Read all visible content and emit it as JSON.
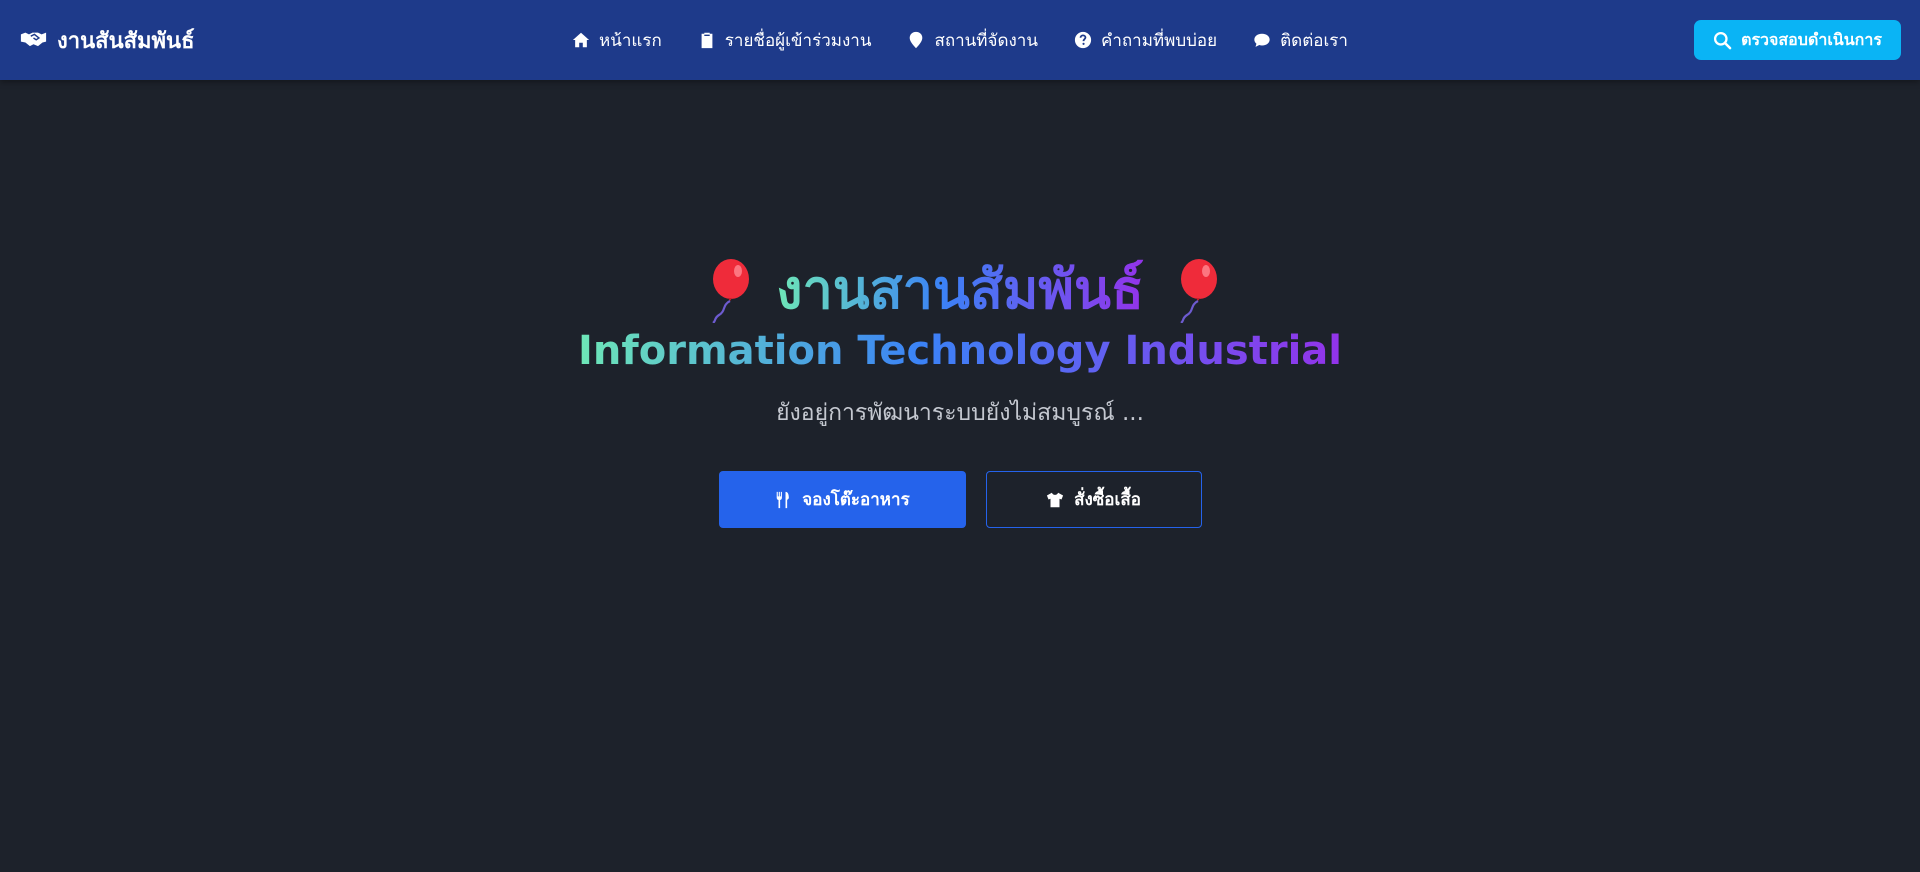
{
  "navbar": {
    "brand_icon": "handshake-icon",
    "brand_label": "งานสันสัมพันธ์",
    "links": [
      {
        "icon": "home-icon",
        "label": "หน้าแรก"
      },
      {
        "icon": "clipboard-icon",
        "label": "รายชื่อผู้เข้าร่วมงาน"
      },
      {
        "icon": "map-pin-icon",
        "label": "สถานที่จัดงาน"
      },
      {
        "icon": "question-circle-icon",
        "label": "คำถามที่พบบ่อย"
      },
      {
        "icon": "chat-bubble-icon",
        "label": "ติดต่อเรา"
      }
    ],
    "check_button": {
      "icon": "search-icon",
      "label": "ตรวจสอบดำเนินการ"
    }
  },
  "hero": {
    "title": "งานสานสัมพันธ์",
    "title_icon": "balloon-icon",
    "subtitle": "Information Technology Industrial",
    "description": "ยังอยู่การพัฒนาระบบยังไม่สมบูรณ์ ...",
    "primary_button": {
      "icon": "utensils-icon",
      "label": "จองโต๊ะอาหาร"
    },
    "secondary_button": {
      "icon": "shirt-icon",
      "label": "สั่งซื้อเสื้อ"
    }
  },
  "colors": {
    "navbar_bg": "#1e3a8a",
    "page_bg": "#1d222b",
    "accent_cyan": "#0ab4f5",
    "primary_blue": "#2563eb",
    "gradient_start": "#6ee7b7",
    "gradient_mid": "#3b82f6",
    "gradient_end": "#9333ea"
  }
}
